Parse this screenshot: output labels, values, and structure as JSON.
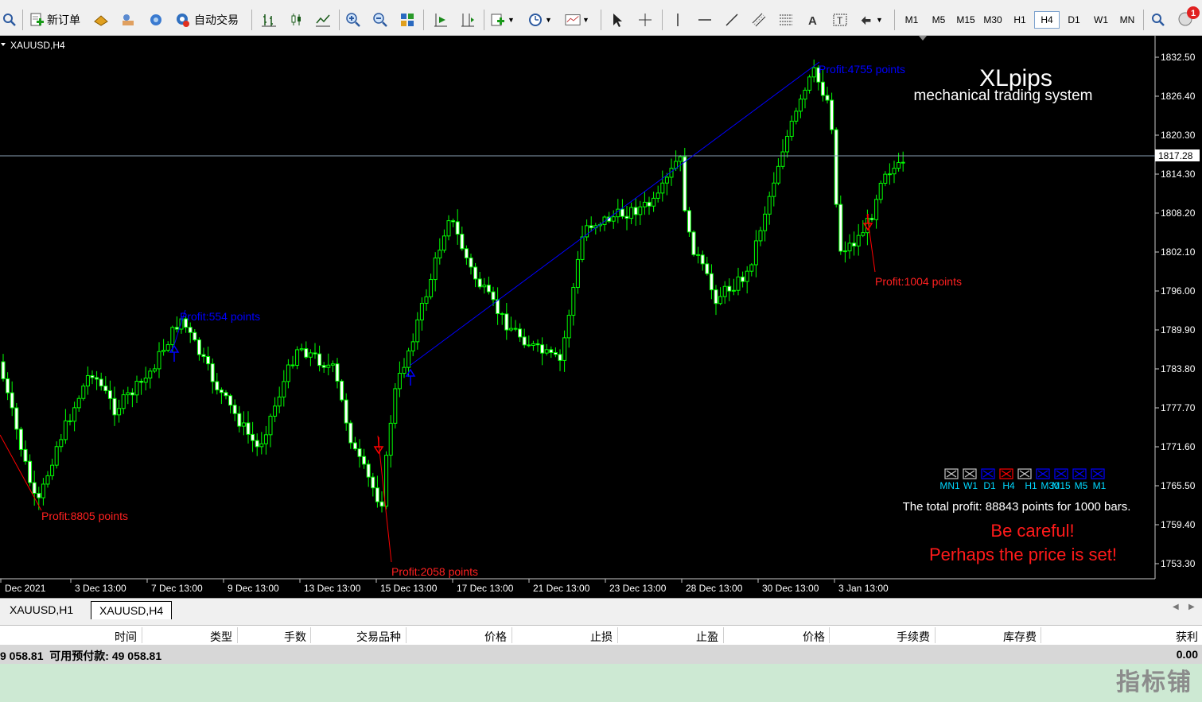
{
  "toolbar": {
    "new_order_label": "新订单",
    "auto_trade_label": "自动交易",
    "timeframes": [
      "M1",
      "M5",
      "M15",
      "M30",
      "H1",
      "H4",
      "D1",
      "W1",
      "MN"
    ],
    "active_timeframe": "H4",
    "notification_count": "1"
  },
  "chart": {
    "symbol_label": "XAUUSD,H4",
    "brand_title": "XLpips",
    "brand_subtitle": "mechanical trading system",
    "current_price": "1817.28",
    "price_ticks": [
      "1832.50",
      "1826.40",
      "1820.30",
      "1814.30",
      "1808.20",
      "1802.10",
      "1796.00",
      "1789.90",
      "1783.80",
      "1777.70",
      "1771.60",
      "1765.50",
      "1759.40",
      "1753.30"
    ],
    "time_ticks": [
      "Dec 2021",
      "3 Dec 13:00",
      "7 Dec 13:00",
      "9 Dec 13:00",
      "13 Dec 13:00",
      "15 Dec 13:00",
      "17 Dec 13:00",
      "21 Dec 13:00",
      "23 Dec 13:00",
      "28 Dec 13:00",
      "30 Dec 13:00",
      "3 Jan 13:00"
    ],
    "profit_labels": {
      "p8805": "Profit:8805 points",
      "p554": "Profit:554 points",
      "p2058": "Profit:2058 points",
      "p4755": "Profit:4755 points",
      "p1004": "Profit:1004 points"
    },
    "tf_panel": [
      {
        "label": "MN1",
        "state": "neutral"
      },
      {
        "label": "W1",
        "state": "neutral"
      },
      {
        "label": "D1",
        "state": "up"
      },
      {
        "label": "H4",
        "state": "down"
      },
      {
        "label": "H1",
        "state": "neutral"
      },
      {
        "label": "M30",
        "state": "up"
      },
      {
        "label": "M15",
        "state": "up"
      },
      {
        "label": "M5",
        "state": "up"
      },
      {
        "label": "M1",
        "state": "up"
      }
    ],
    "total_profit_text": "The total profit: 88843 points for 1000 bars.",
    "warning_line1": "Be careful!",
    "warning_line2": "Perhaps the price is set!",
    "colors": {
      "bull": "#00ff00",
      "bear": "#ffffff",
      "buy": "#0000ff",
      "sell": "#ff0000",
      "bg": "#000000"
    }
  },
  "chart_tabs": [
    "XAUUSD,H1",
    "XAUUSD,H4"
  ],
  "active_chart_tab": "XAUUSD,H4",
  "terminal": {
    "columns": [
      "时间",
      "类型",
      "手数",
      "交易品种",
      "价格",
      "止损",
      "止盈",
      "价格",
      "手续费",
      "库存费",
      "获利"
    ],
    "balance_text": "9 058.81  可用预付款: 49 058.81",
    "profit_total": "0.00"
  },
  "watermark": "指标铺"
}
